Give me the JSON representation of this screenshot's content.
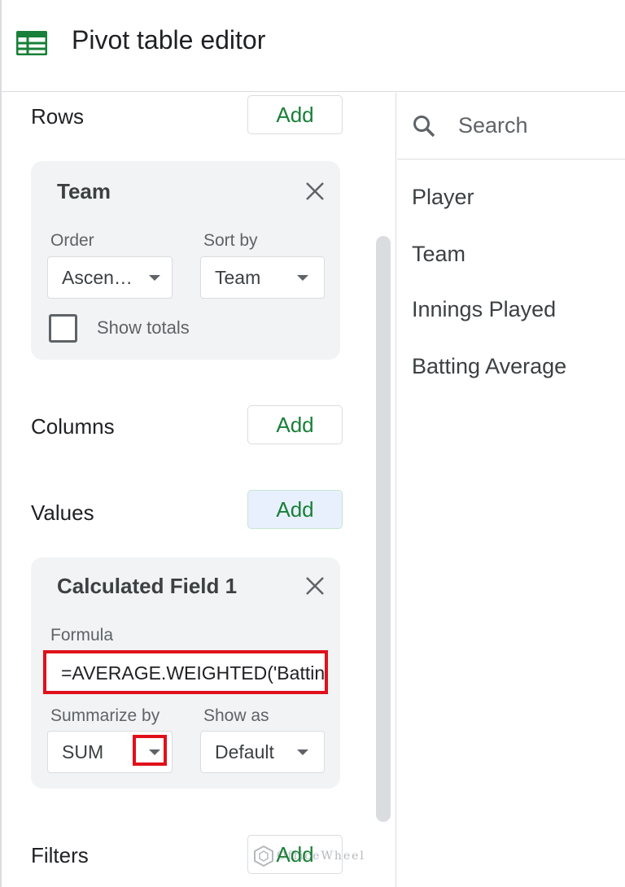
{
  "header": {
    "title": "Pivot table editor",
    "icon": "sheets-icon",
    "accent": "#188038"
  },
  "rows": {
    "label": "Rows",
    "add_label": "Add",
    "card": {
      "title": "Team",
      "order_label": "Order",
      "order_value": "Ascen…",
      "sort_label": "Sort by",
      "sort_value": "Team",
      "show_totals_label": "Show totals",
      "show_totals_checked": false
    }
  },
  "columns": {
    "label": "Columns",
    "add_label": "Add"
  },
  "values": {
    "label": "Values",
    "add_label": "Add",
    "card": {
      "title": "Calculated Field 1",
      "formula_label": "Formula",
      "formula_value": "=AVERAGE.WEIGHTED('Battin",
      "summarize_label": "Summarize by",
      "summarize_value": "SUM",
      "show_as_label": "Show as",
      "show_as_value": "Default"
    }
  },
  "filters": {
    "label": "Filters",
    "add_label": "Add"
  },
  "search": {
    "placeholder": "Search"
  },
  "fields": [
    "Player",
    "Team",
    "Innings Played",
    "Batting Average"
  ],
  "watermark": "OfficeWheel",
  "colors": {
    "highlight": "#e0101a",
    "add_text": "#188038",
    "card_bg": "#f1f3f4"
  }
}
